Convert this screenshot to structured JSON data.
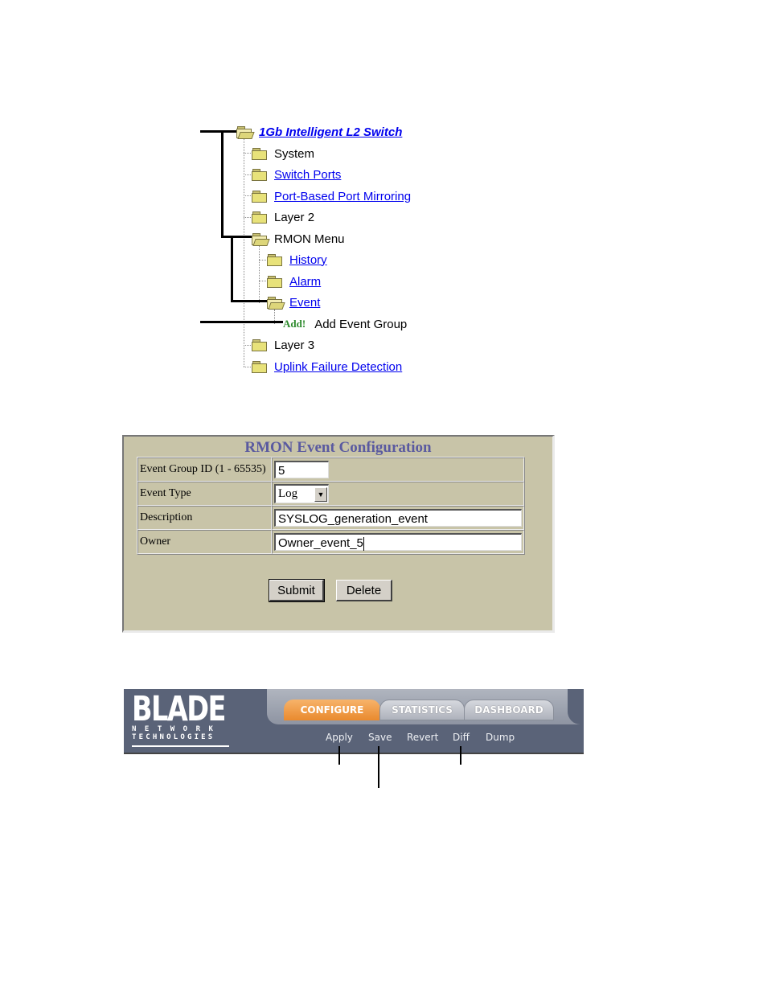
{
  "tree": {
    "root": {
      "label": "1Gb Intelligent L2 Switch",
      "icon": "folder-open-icon",
      "link": true
    },
    "items": [
      {
        "label": "System",
        "icon": "folder-icon",
        "link": false
      },
      {
        "label": "Switch Ports",
        "icon": "folder-icon",
        "link": true
      },
      {
        "label": "Port-Based Port Mirroring",
        "icon": "folder-icon",
        "link": true
      },
      {
        "label": "Layer 2",
        "icon": "folder-icon",
        "link": false
      },
      {
        "label": "RMON Menu",
        "icon": "folder-open-icon",
        "link": false
      },
      {
        "label": "History",
        "icon": "folder-icon",
        "link": true
      },
      {
        "label": "Alarm",
        "icon": "folder-icon",
        "link": true
      },
      {
        "label": "Event",
        "icon": "folder-open-icon",
        "link": true
      },
      {
        "label": "Add Event Group",
        "badge": "Add!",
        "link": false
      },
      {
        "label": "Layer 3",
        "icon": "folder-icon",
        "link": false
      },
      {
        "label": "Uplink Failure Detection",
        "icon": "folder-icon",
        "link": true
      }
    ]
  },
  "form": {
    "title": "RMON Event Configuration",
    "fields": [
      {
        "label": "Event Group ID (1 - 65535)",
        "value": "5",
        "type": "text"
      },
      {
        "label": "Event Type",
        "value": "Log",
        "type": "select"
      },
      {
        "label": "Description",
        "value": "SYSLOG_generation_event",
        "type": "text"
      },
      {
        "label": "Owner",
        "value": "Owner_event_5",
        "type": "text"
      }
    ],
    "buttons": {
      "submit": "Submit",
      "delete": "Delete"
    }
  },
  "header": {
    "logo": {
      "main": "BLADE",
      "line1": "NETWORK",
      "line2": "TECHNOLOGIES"
    },
    "tabs": [
      {
        "label": "CONFIGURE",
        "active": true
      },
      {
        "label": "STATISTICS",
        "active": false
      },
      {
        "label": "DASHBOARD",
        "active": false
      }
    ],
    "actions": [
      "Apply",
      "Save",
      "Revert",
      "Diff",
      "Dump"
    ],
    "colors": {
      "bar": "#5a6378",
      "active_tab": "#e98a2e"
    }
  }
}
